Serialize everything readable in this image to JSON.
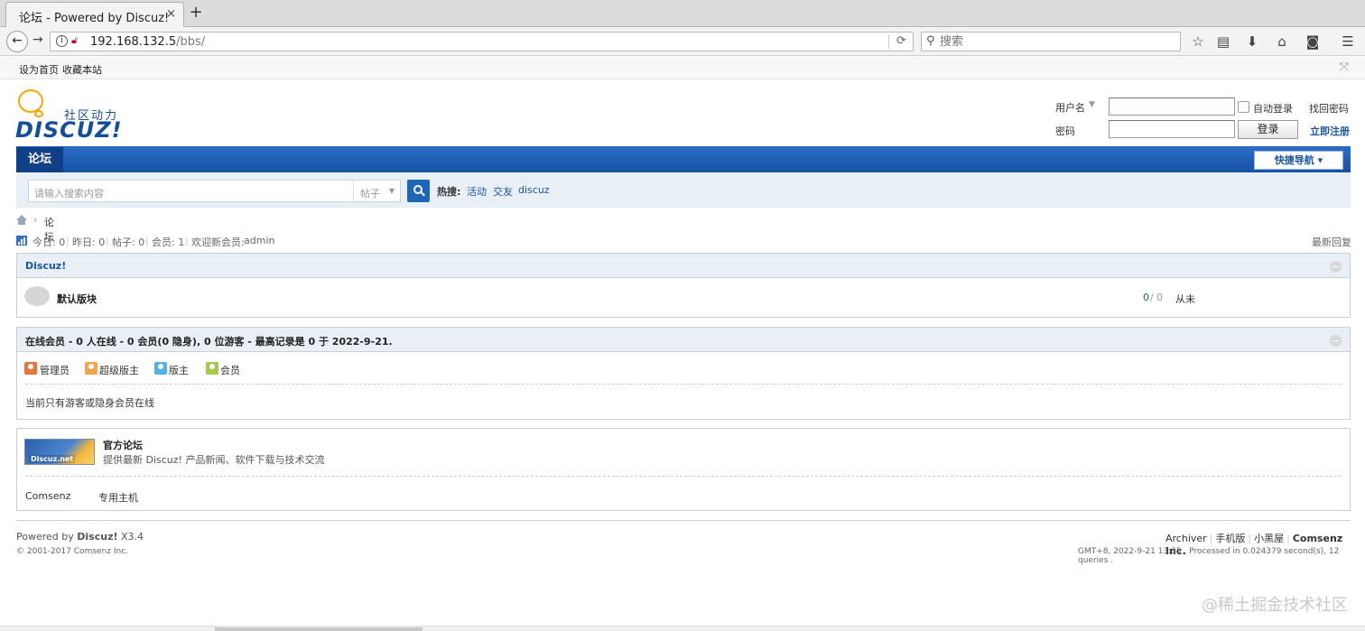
{
  "browser": {
    "tab_title": "论坛 - Powered by Discuz!",
    "tab_close": "×",
    "new_tab": "+",
    "url_host": "192.168.132.5",
    "url_path": "/bbs/",
    "search_placeholder": "搜索",
    "bookmarks": [
      "设为首页",
      "收藏本站"
    ]
  },
  "site": {
    "logo_tagline": "社区动力",
    "logo_text": "DISCUZ!"
  },
  "login": {
    "username_label": "用户名",
    "password_label": "密码",
    "auto_login": "自动登录",
    "find_password": "找回密码",
    "login_button": "登录",
    "register": "立即注册"
  },
  "nav": {
    "active_tab": "论坛",
    "quick_nav": "快捷导航 ▾"
  },
  "searchbar": {
    "placeholder": "请输入搜索内容",
    "type": "帖子",
    "hot_label": "热搜:",
    "hot_terms": [
      "活动",
      "交友",
      "discuz"
    ]
  },
  "breadcrumb": {
    "current": "论坛"
  },
  "stats": {
    "today": "今日: 0",
    "yesterday": "昨日: 0",
    "posts": "帖子: 0",
    "members": "会员: 1",
    "welcome": "欢迎新会员: ",
    "newest_member": "admin",
    "latest_reply": "最新回复"
  },
  "category": {
    "title": "Discuz!",
    "forum_name": "默认版块",
    "counts_threads": "0",
    "counts_posts": "0",
    "last_post": "从未"
  },
  "online": {
    "title": "在线会员 - 0 人在线 - 0 会员(0 隐身), 0 位游客 - 最高记录是 0 于 2022-9-21.",
    "legend": [
      {
        "label": "管理员",
        "color": "#e8763b"
      },
      {
        "label": "超级版主",
        "color": "#f0a54a"
      },
      {
        "label": "版主",
        "color": "#4fb3e6"
      },
      {
        "label": "会员",
        "color": "#a5c94b"
      }
    ],
    "status": "当前只有游客或隐身会员在线"
  },
  "links": {
    "banner_text": "Discuz.net",
    "official_title": "官方论坛",
    "official_desc": "提供最新 Discuz! 产品新闻、软件下载与技术交流",
    "text_links": [
      "Comsenz",
      "专用主机"
    ]
  },
  "footer": {
    "powered": "Powered by ",
    "product": "Discuz!",
    "version": " X3.4",
    "copyright": "© 2001-2017 Comsenz Inc.",
    "links": [
      "Archiver",
      "手机版",
      "小黑屋"
    ],
    "company": "Comsenz Inc.",
    "timing": "GMT+8, 2022-9-21 13:35 , Processed in 0.024379 second(s), 12 queries ."
  },
  "watermark": "@稀土掘金技术社区"
}
